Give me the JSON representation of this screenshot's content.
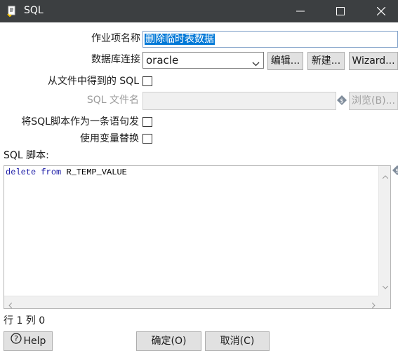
{
  "window": {
    "title": "SQL",
    "app_icon": "sql-script-icon"
  },
  "form": {
    "job_name_label": "作业项名称",
    "job_name_value": "删除临时表数据",
    "db_connection_label": "数据库连接",
    "db_connection_value": "oracle",
    "edit_button": "编辑...",
    "new_button": "新建...",
    "wizard_button": "Wizard...",
    "from_file_label": "从文件中得到的 SQL",
    "sql_filename_label": "SQL 文件名",
    "browse_button": "浏览(B)...",
    "single_statement_label": "将SQL脚本作为一条语句发",
    "use_variables_label": "使用变量替换",
    "sql_script_label": "SQL 脚本:"
  },
  "editor": {
    "keyword1": "delete",
    "keyword2": "from",
    "table": "R_TEMP_VALUE"
  },
  "status": {
    "position": "行 1 列 0"
  },
  "footer": {
    "help_button": "Help",
    "ok_button": "确定(O)",
    "cancel_button": "取消(C)"
  },
  "colors": {
    "titlebar": "#3c3f41",
    "selection": "#0078d7",
    "keyword": "#1a1aa6"
  }
}
